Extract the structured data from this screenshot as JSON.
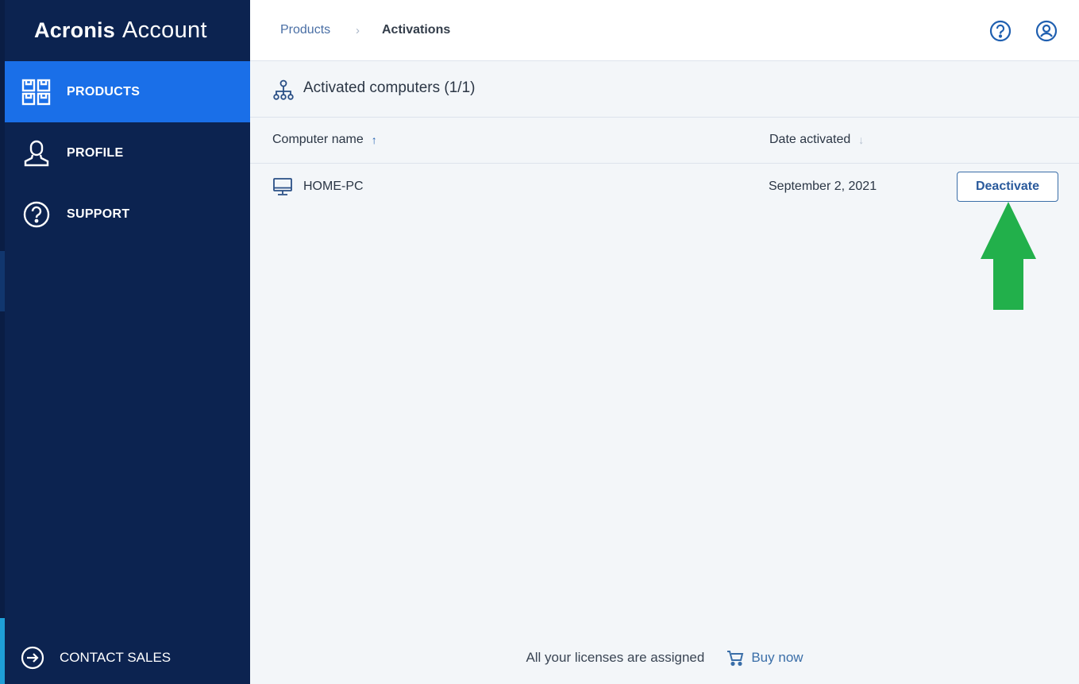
{
  "app": {
    "brand": "Acronis",
    "product": "Account"
  },
  "sidebar": {
    "items": [
      {
        "label": "PRODUCTS",
        "icon": "products-icon",
        "active": true
      },
      {
        "label": "PROFILE",
        "icon": "profile-icon",
        "active": false
      },
      {
        "label": "SUPPORT",
        "icon": "support-icon",
        "active": false
      }
    ],
    "contact": {
      "label": "CONTACT SALES",
      "icon": "arrow-right-circle-icon"
    }
  },
  "breadcrumb": {
    "items": [
      "Products",
      "Activations"
    ],
    "separator": "›"
  },
  "header_icons": [
    "help-icon",
    "account-icon"
  ],
  "panel": {
    "title": "Activated computers (1/1)",
    "icon": "network-icon"
  },
  "table": {
    "columns": [
      {
        "label": "Computer name",
        "sort": "↑"
      },
      {
        "label": "Date activated",
        "sort": "↓"
      }
    ],
    "rows": [
      {
        "name": "HOME-PC",
        "date": "September 2, 2021",
        "action": "Deactivate"
      }
    ]
  },
  "footer": {
    "status": "All your licenses are assigned",
    "buy_label": "Buy now"
  },
  "colors": {
    "sidebar_bg": "#0c2350",
    "active_bg": "#1a6fe8",
    "content_bg": "#f3f6f9",
    "link": "#4a6fa5",
    "annotation_arrow": "#22b04b"
  }
}
